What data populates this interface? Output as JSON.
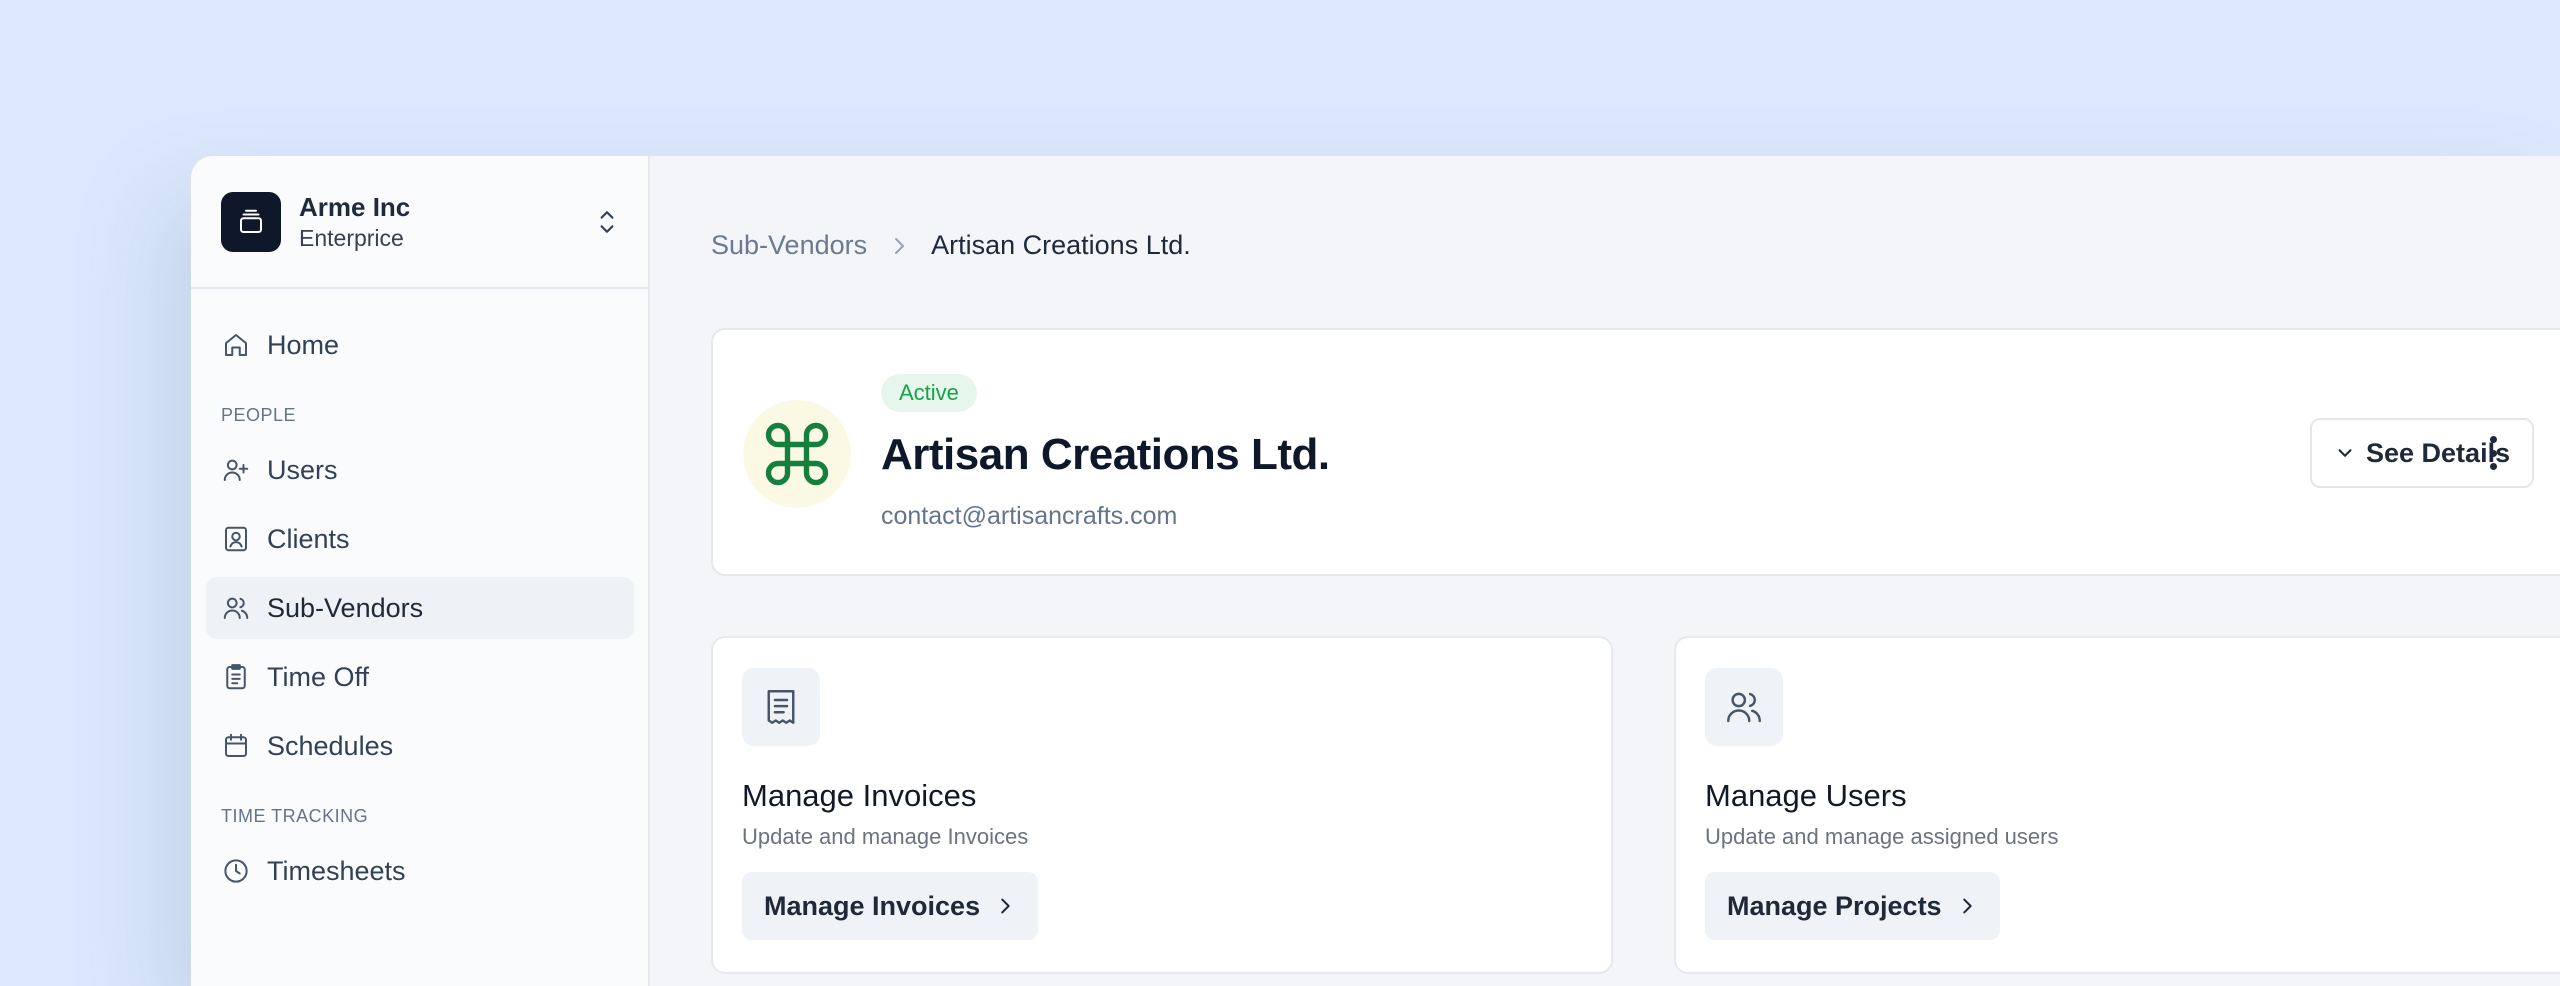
{
  "org": {
    "name": "Arme Inc",
    "plan": "Enterprice"
  },
  "nav": {
    "home": "Home",
    "section_people": "PEOPLE",
    "users": "Users",
    "clients": "Clients",
    "subvendors": "Sub-Vendors",
    "timeoff": "Time Off",
    "schedules": "Schedules",
    "section_time": "TIME TRACKING",
    "timesheets": "Timesheets"
  },
  "breadcrumb": {
    "parent": "Sub-Vendors",
    "current": "Artisan Creations Ltd."
  },
  "vendor": {
    "status": "Active",
    "name": "Artisan Creations Ltd.",
    "email": "contact@artisancrafts.com",
    "see_details_label": "See Details"
  },
  "cards": {
    "invoices": {
      "title": "Manage Invoices",
      "desc": "Update and manage Invoices",
      "button": "Manage Invoices"
    },
    "users": {
      "title": "Manage Users",
      "desc": "Update and manage assigned users",
      "button": "Manage Projects"
    }
  },
  "colors": {
    "background": "#dce8fb",
    "status_green": "#16a34a",
    "logo_green": "#15803d",
    "dark": "#0f172a"
  }
}
